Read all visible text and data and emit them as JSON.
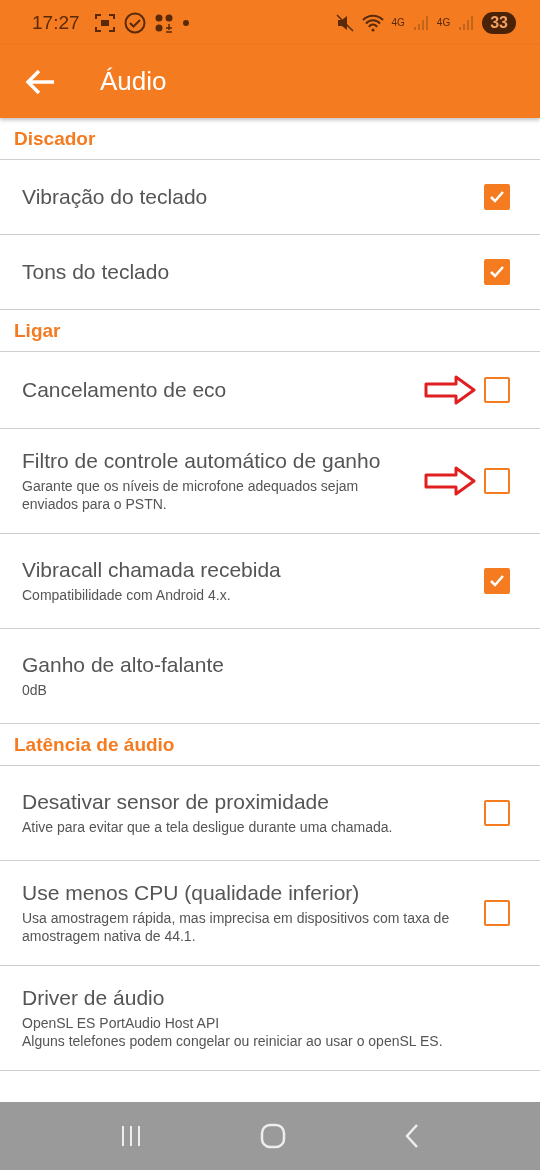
{
  "status_bar": {
    "time": "17:27",
    "network_1": "4G",
    "network_2": "4G",
    "battery": "33"
  },
  "app_bar": {
    "title": "Áudio"
  },
  "sections": [
    {
      "title": "Discador",
      "items": [
        {
          "kind": "checkbox",
          "title": "Vibração do teclado",
          "checked": true,
          "annotated": false
        },
        {
          "kind": "checkbox",
          "title": "Tons do teclado",
          "checked": true,
          "annotated": false
        }
      ]
    },
    {
      "title": "Ligar",
      "items": [
        {
          "kind": "checkbox",
          "title": "Cancelamento de eco",
          "checked": false,
          "annotated": true
        },
        {
          "kind": "checkbox",
          "title": "Filtro de controle automático de ganho",
          "subtitle": "Garante que os níveis de microfone adequados sejam enviados para o PSTN.",
          "checked": false,
          "annotated": true
        },
        {
          "kind": "checkbox",
          "title": "Vibracall chamada recebida",
          "subtitle": "Compatibilidade com Android 4.x.",
          "checked": true,
          "annotated": false
        },
        {
          "kind": "plain",
          "title": "Ganho de alto-falante",
          "subtitle": "0dB"
        }
      ]
    },
    {
      "title": "Latência de áudio",
      "items": [
        {
          "kind": "checkbox",
          "title": "Desativar sensor de proximidade",
          "subtitle": "Ative para evitar que a tela desligue durante uma chamada.",
          "checked": false,
          "annotated": false
        },
        {
          "kind": "checkbox",
          "title": "Use menos CPU (qualidade inferior)",
          "subtitle": "Usa amostragem rápida, mas imprecisa em dispositivos com taxa de amostragem nativa de 44.1.",
          "checked": false,
          "annotated": false
        },
        {
          "kind": "plain",
          "title": "Driver de áudio",
          "subtitle": "OpenSL ES PortAudio Host API\nAlguns telefones podem congelar ou reiniciar ao usar o openSL ES."
        }
      ]
    }
  ]
}
